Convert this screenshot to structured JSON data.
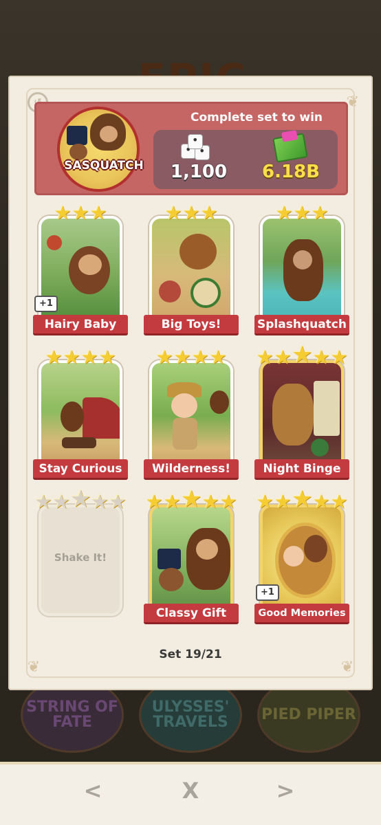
{
  "background": {
    "title": "EPIC",
    "albums": [
      "STRING OF FATE",
      "ULYSSES' TRAVELS",
      "PIED PIPER"
    ]
  },
  "header": {
    "title": "Complete set to win",
    "set_name": "SASQUATCH",
    "reward_dice": "1,100",
    "reward_cash": "6.18B"
  },
  "stickers": [
    {
      "name": "Hairy Baby",
      "stars": 3,
      "badge": "+1",
      "collected": true
    },
    {
      "name": "Big Toys!",
      "stars": 3,
      "badge": "",
      "collected": true
    },
    {
      "name": "Splashquatch",
      "stars": 3,
      "badge": "",
      "collected": true
    },
    {
      "name": "Stay Curious",
      "stars": 4,
      "badge": "",
      "collected": true
    },
    {
      "name": "Wilderness!",
      "stars": 4,
      "badge": "",
      "collected": true
    },
    {
      "name": "Night Binge",
      "stars": 5,
      "badge": "",
      "collected": true
    },
    {
      "name": "Shake It!",
      "stars": 5,
      "badge": "",
      "collected": false
    },
    {
      "name": "Classy Gift",
      "stars": 5,
      "badge": "",
      "collected": true
    },
    {
      "name": "Good Memories",
      "stars": 5,
      "badge": "+1",
      "collected": true
    }
  ],
  "footer": {
    "set_counter": "Set 19/21"
  },
  "nav": {
    "prev": "<",
    "close": "X",
    "next": ">"
  },
  "colors": {
    "header_bg": "#c56564",
    "ribbon": "#c33a3f",
    "star": "#f5cc31",
    "card_bg": "#f3ece0",
    "cash_text": "#f9e04a"
  }
}
